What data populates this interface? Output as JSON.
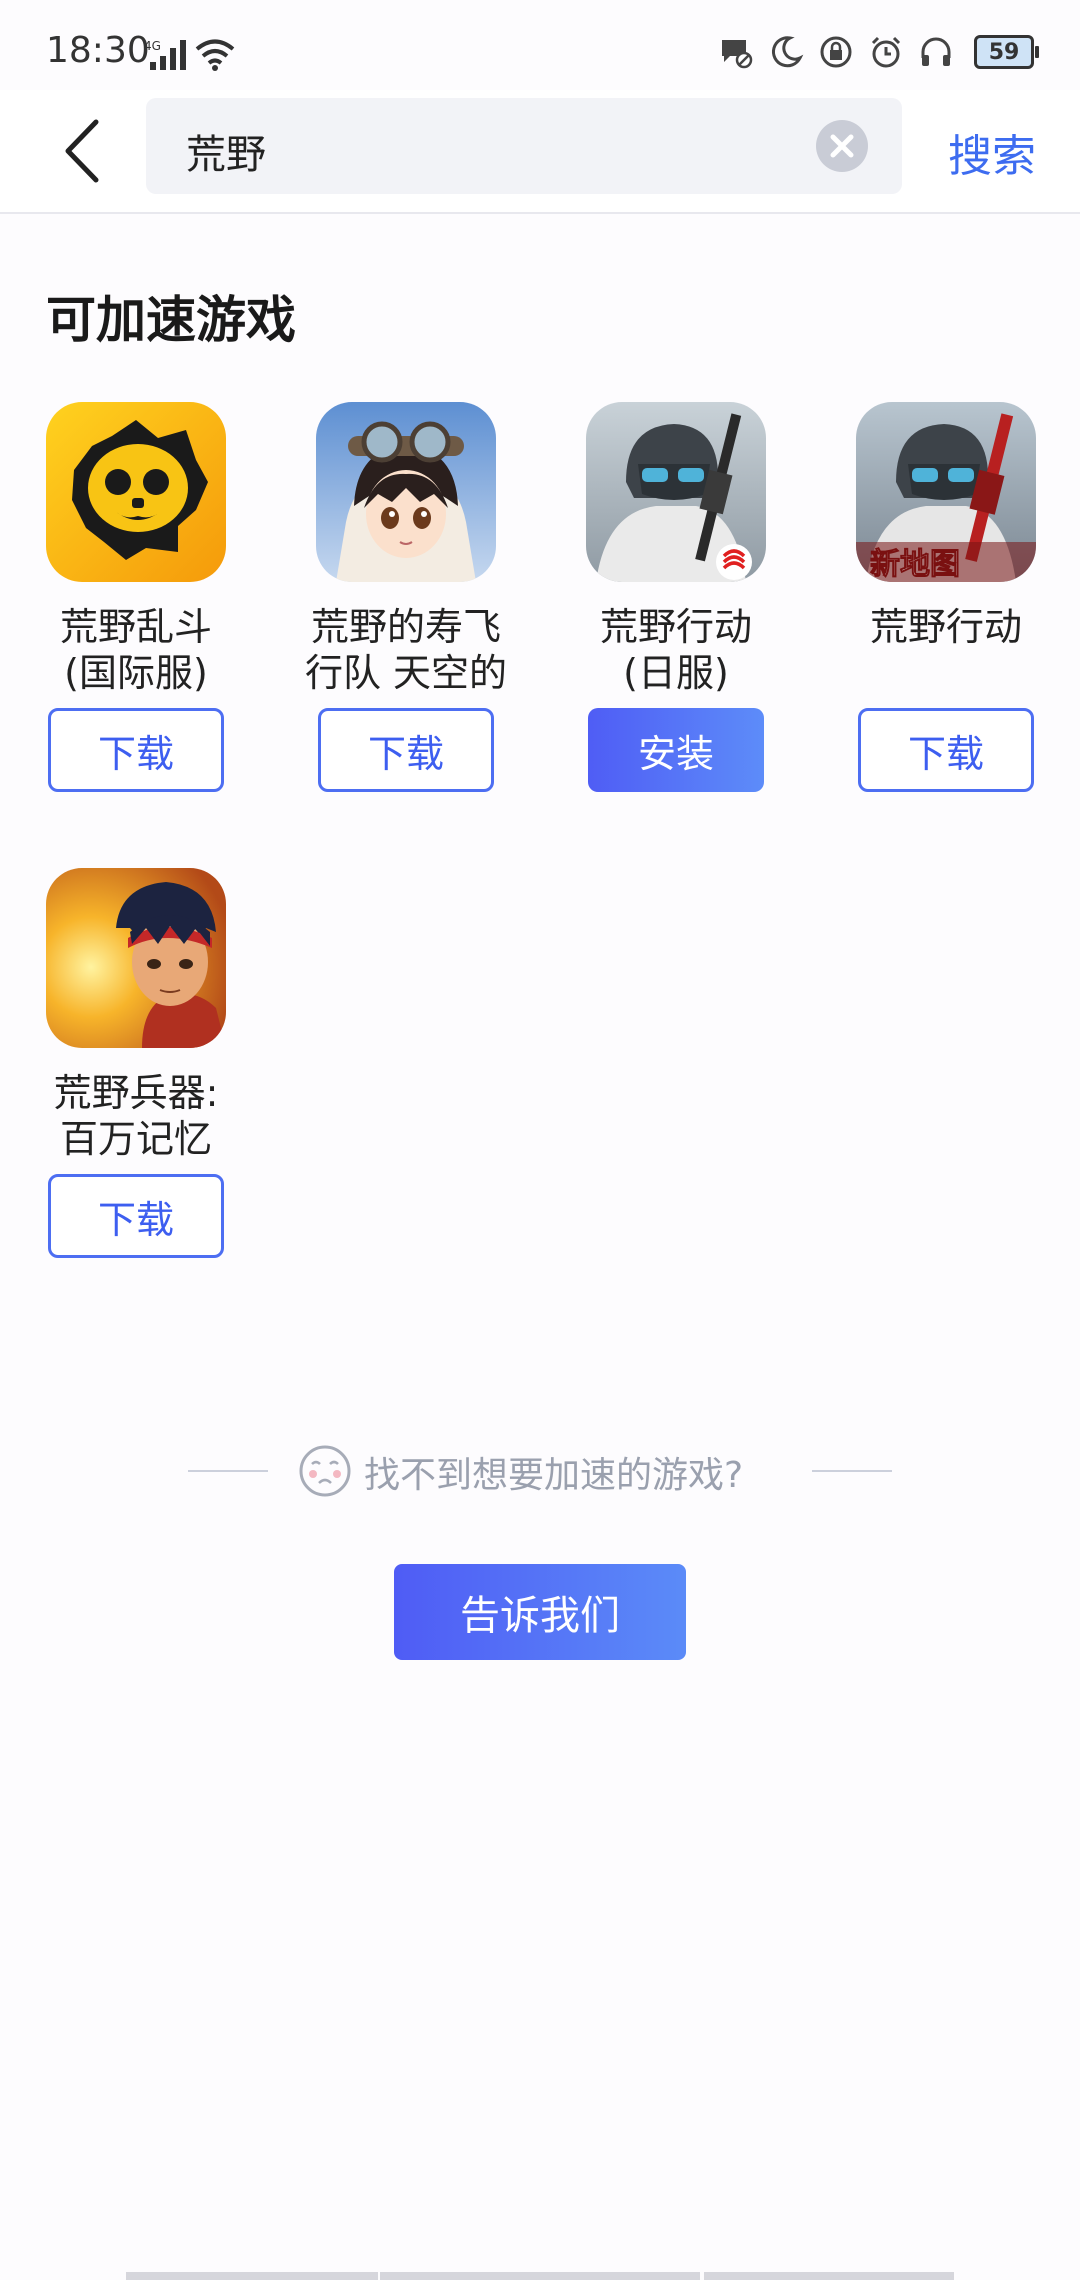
{
  "status_bar": {
    "time": "18:30",
    "network": "4G",
    "battery": "59"
  },
  "header": {
    "search_value": "荒野",
    "search_button": "搜索"
  },
  "section": {
    "title": "可加速游戏"
  },
  "games": [
    {
      "name_line1": "荒野乱斗",
      "name_line2": "(国际服)",
      "button": "下载",
      "icon": "brawl-stars-skull-icon"
    },
    {
      "name_line1": "荒野的寿飞",
      "name_line2": "行队 天空的",
      "button": "下载",
      "icon": "pilot-girl-icon"
    },
    {
      "name_line1": "荒野行动",
      "name_line2": "(日服)",
      "button": "安装",
      "icon": "soldier-netease-icon"
    },
    {
      "name_line1": "荒野行动",
      "name_line2": "",
      "button": "下载",
      "icon": "soldier-new-map-icon",
      "badge": "新地图"
    },
    {
      "name_line1": "荒野兵器:",
      "name_line2": "百万记忆",
      "button": "下载",
      "icon": "warrior-sunset-icon"
    }
  ],
  "not_found": {
    "text": "找不到想要加速的游戏?",
    "button": "告诉我们"
  },
  "colors": {
    "accent": "#3d6cf0",
    "primary_gradient_start": "#4f5df5",
    "primary_gradient_end": "#5d8cf9"
  }
}
